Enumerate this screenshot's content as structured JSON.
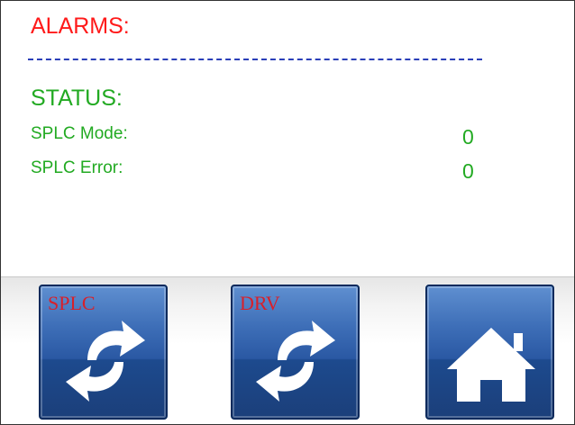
{
  "alarms": {
    "title": "ALARMS:"
  },
  "status": {
    "title": "STATUS:",
    "rows": [
      {
        "label": "SPLC Mode:",
        "value": "0"
      },
      {
        "label": "SPLC Error:",
        "value": "0"
      }
    ]
  },
  "toolbar": {
    "splc_refresh_tag": "SPLC",
    "drv_refresh_tag": "DRV",
    "icons": [
      "refresh-icon",
      "refresh-icon",
      "home-icon"
    ]
  },
  "colors": {
    "alarm_text": "#ff1a1a",
    "status_text": "#22aa22",
    "divider": "#2a3fb8",
    "button_blue": "#2a58a3",
    "tag_red": "#d8202a"
  }
}
